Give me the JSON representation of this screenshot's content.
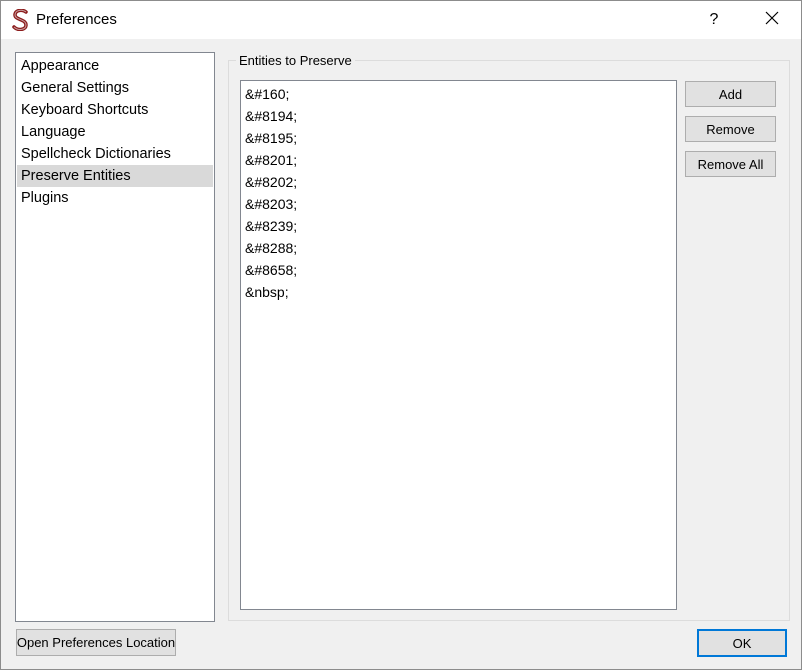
{
  "window": {
    "title": "Preferences",
    "help_label": "?",
    "close_label": "✕"
  },
  "sidebar": {
    "items": [
      {
        "label": "Appearance"
      },
      {
        "label": "General Settings"
      },
      {
        "label": "Keyboard Shortcuts"
      },
      {
        "label": "Language"
      },
      {
        "label": "Spellcheck Dictionaries"
      },
      {
        "label": "Preserve Entities",
        "selected": true
      },
      {
        "label": "Plugins"
      }
    ]
  },
  "main": {
    "group_title": "Entities to Preserve",
    "entities": [
      "&#160;",
      "&#8194;",
      "&#8195;",
      "&#8201;",
      "&#8202;",
      "&#8203;",
      "&#8239;",
      "&#8288;",
      "&#8658;",
      "&nbsp;"
    ],
    "buttons": {
      "add": "Add",
      "remove": "Remove",
      "remove_all": "Remove All"
    }
  },
  "footer": {
    "open_location": "Open Preferences Location",
    "ok": "OK"
  },
  "colors": {
    "selected_bg": "#d9d9d9",
    "default_button_border": "#0078d7",
    "app_icon": "#8b1a1a"
  },
  "icons": {
    "app": "sigil-s-icon"
  }
}
